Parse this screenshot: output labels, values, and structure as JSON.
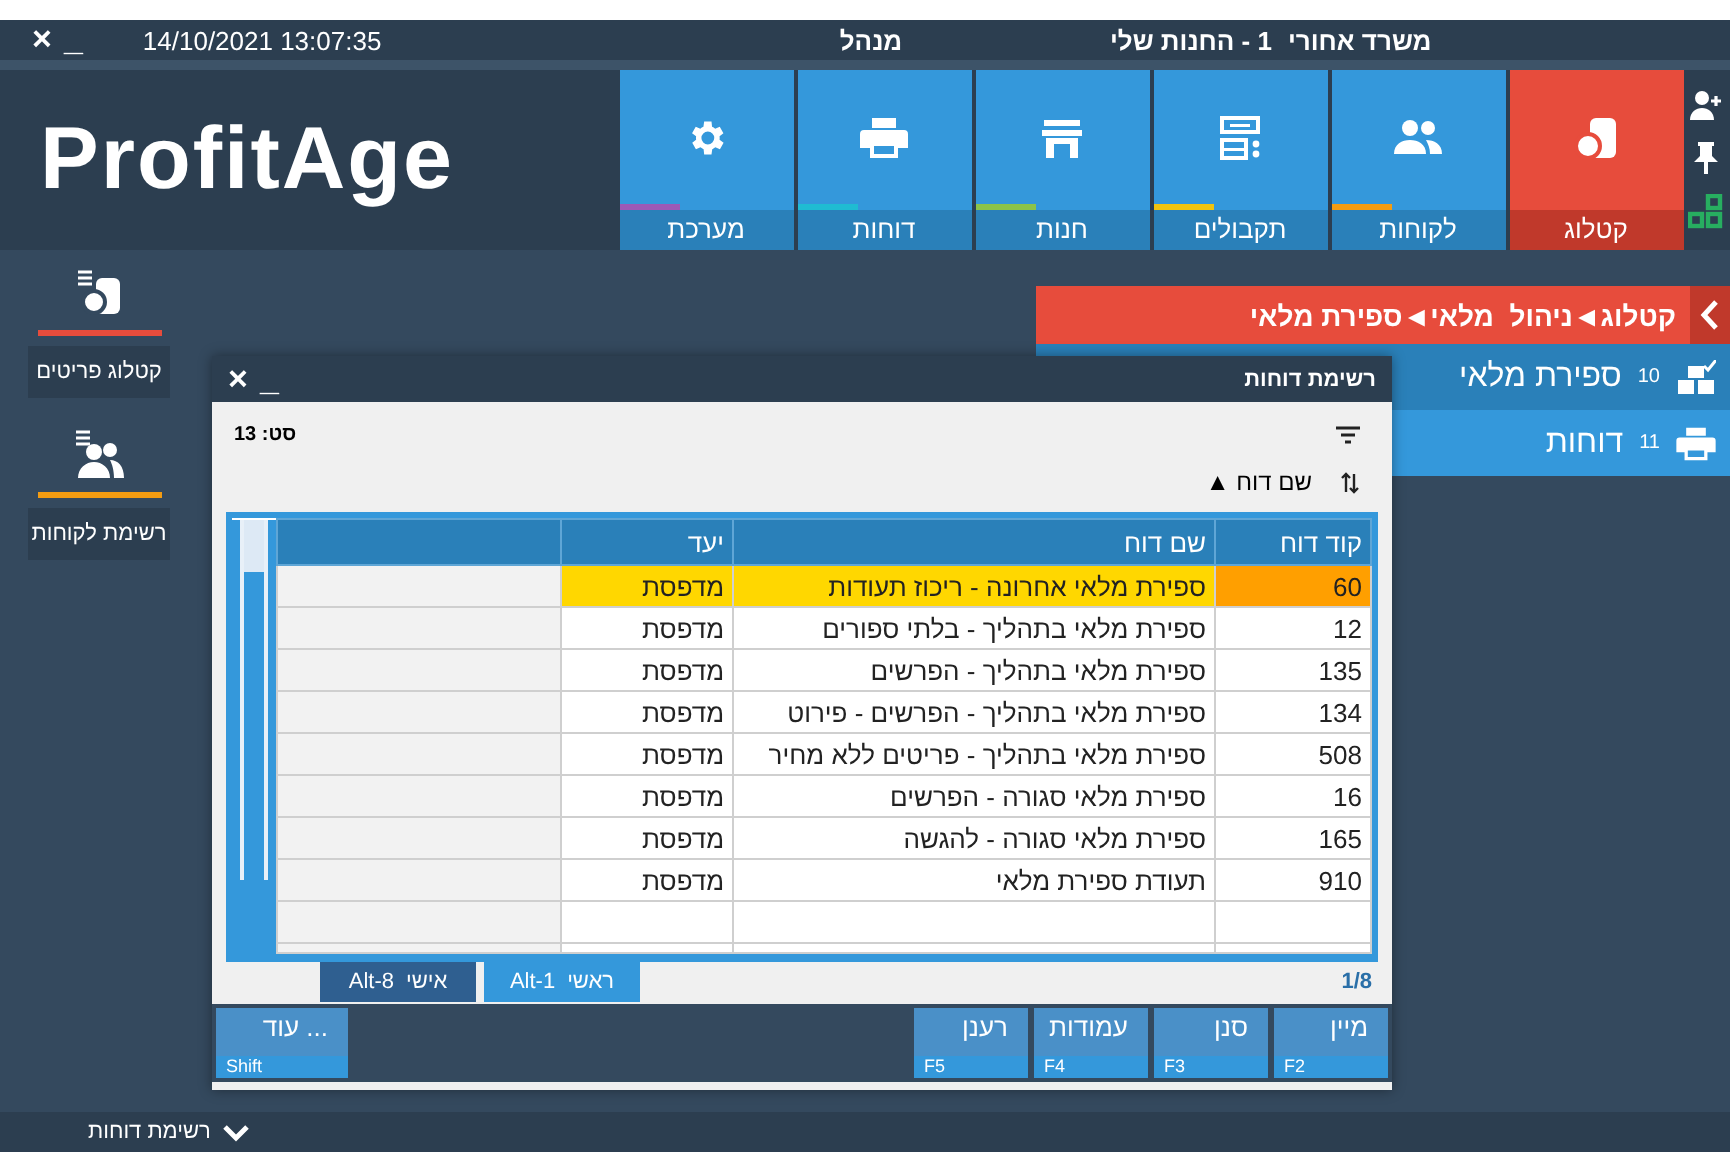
{
  "title_bar": {
    "close": "×",
    "minimize": "_",
    "datetime": "14/10/2021 13:07:35",
    "user": "מנהל",
    "branch": "1 - החנות שלי",
    "location": "משרד אחורי"
  },
  "logo": "ProfitAge",
  "modules": [
    {
      "label": "קטלוג",
      "selected": true
    },
    {
      "label": "לקוחות",
      "selected": false,
      "color": "#f39c12"
    },
    {
      "label": "תקבולים",
      "selected": false,
      "color": "#f1c40f"
    },
    {
      "label": "חנות",
      "selected": false,
      "color": "#8bc34a"
    },
    {
      "label": "דוחות",
      "selected": false,
      "color": "#1fbcd2"
    },
    {
      "label": "מערכת",
      "selected": false,
      "color": "#9b59b6"
    }
  ],
  "sidebar": [
    {
      "label": "קטלוג פריטים",
      "color": "#e74c3c"
    },
    {
      "label": "רשימת לקוחות",
      "color": "#f39c12"
    }
  ],
  "breadcrumb": "קטלוג◄ניהול  מלאי◄ספירת מלאי",
  "nav_items": [
    {
      "number": "10",
      "label": "ספירת מלאי",
      "selected": true
    },
    {
      "number": "11",
      "label": "דוחות",
      "selected": false
    }
  ],
  "dialog": {
    "title": "רשימת דוחות",
    "close": "×",
    "minimize": "_",
    "total": "סט: 13",
    "sort": "שם דוח ▲",
    "columns": [
      "קוד דוח",
      "שם דוח",
      "יעד"
    ],
    "rows": [
      {
        "code": "60",
        "name": "ספירת מלאי אחרונה - ריכוז תעודות",
        "target": "מדפסת",
        "selected": true
      },
      {
        "code": "12",
        "name": "ספירת מלאי בתהליך - בלתי ספורים",
        "target": "מדפסת",
        "selected": false
      },
      {
        "code": "135",
        "name": "ספירת מלאי בתהליך - הפרשים",
        "target": "מדפסת",
        "selected": false
      },
      {
        "code": "134",
        "name": "ספירת מלאי בתהליך - הפרשים - פירוט",
        "target": "מדפסת",
        "selected": false
      },
      {
        "code": "508",
        "name": "ספירת מלאי בתהליך - פריטים ללא מחיר",
        "target": "מדפסת",
        "selected": false
      },
      {
        "code": "16",
        "name": "ספירת מלאי סגורה - הפרשים",
        "target": "מדפסת",
        "selected": false
      },
      {
        "code": "165",
        "name": "ספירת מלאי סגורה - להגשה",
        "target": "מדפסת",
        "selected": false
      },
      {
        "code": "910",
        "name": "תעודת ספירת מלאי",
        "target": "מדפסת",
        "selected": false
      }
    ],
    "pager": "1/8",
    "tabs": [
      {
        "label": "ראשי",
        "key": "Alt-1",
        "selected": true
      },
      {
        "label": "אישי",
        "key": "Alt-8",
        "selected": false
      }
    ],
    "buttons": [
      {
        "label": "מיין",
        "key": "F2"
      },
      {
        "label": "סנן",
        "key": "F3"
      },
      {
        "label": "עמודות",
        "key": "F4"
      },
      {
        "label": "רענן",
        "key": "F5"
      }
    ],
    "more_button": {
      "label": "עוד ...",
      "key": "Shift"
    }
  },
  "bottom_bar": {
    "label": "רשימת דוחות"
  }
}
